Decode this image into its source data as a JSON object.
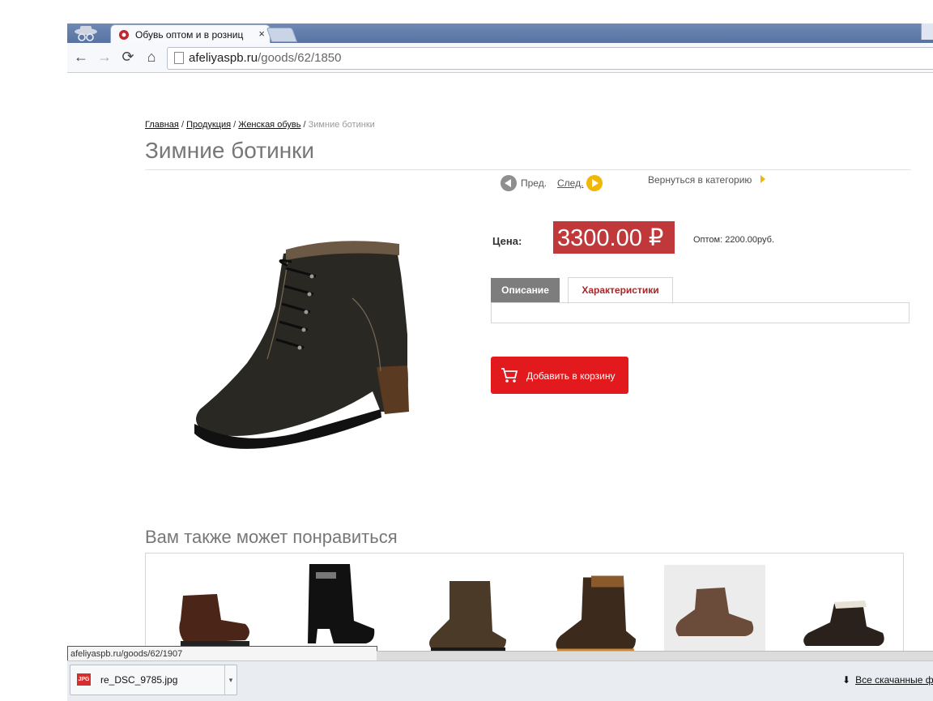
{
  "browser": {
    "tab_title": "Обувь оптом и в розниц",
    "tab_close": "×",
    "url_host": "afeliyaspb.ru",
    "url_path": "/goods/62/1850",
    "nav": {
      "back": "←",
      "forward": "→",
      "reload": "⟳",
      "home": "⌂"
    },
    "minimize": "–"
  },
  "breadcrumb": {
    "home": "Главная",
    "sep": "/",
    "products": "Продукция",
    "women": "Женская обувь",
    "current": "Зимние ботинки"
  },
  "product": {
    "title": "Зимние ботинки",
    "prev_label": "Пред.",
    "next_label": "След.",
    "back_to_category": "Вернуться в категорию",
    "price_label": "Цена:",
    "price_value": "3300.00 ₽",
    "wholesale": "Оптом: 2200.00руб.",
    "tab_description": "Описание",
    "tab_characteristics": "Характеристики",
    "add_to_cart": "Добавить в корзину"
  },
  "related": {
    "title": "Вам также может понравиться",
    "items": [
      {
        "icon": "brown-ankle-boot"
      },
      {
        "icon": "black-heel-boot"
      },
      {
        "icon": "brown-lace-boot"
      },
      {
        "icon": "brown-lace-boot-tall"
      },
      {
        "icon": "brown-low-boot"
      },
      {
        "icon": "fur-lined-shoe"
      }
    ]
  },
  "status_url": "afeliyaspb.ru/goods/62/1907",
  "downloads": {
    "file_name": "re_DSC_9785.jpg",
    "file_type": "JPG",
    "all_label": "Все скачанные ф"
  },
  "colors": {
    "price_bg": "#c0383a",
    "cart_button": "#e2191d",
    "accent_yellow": "#f2b705"
  }
}
